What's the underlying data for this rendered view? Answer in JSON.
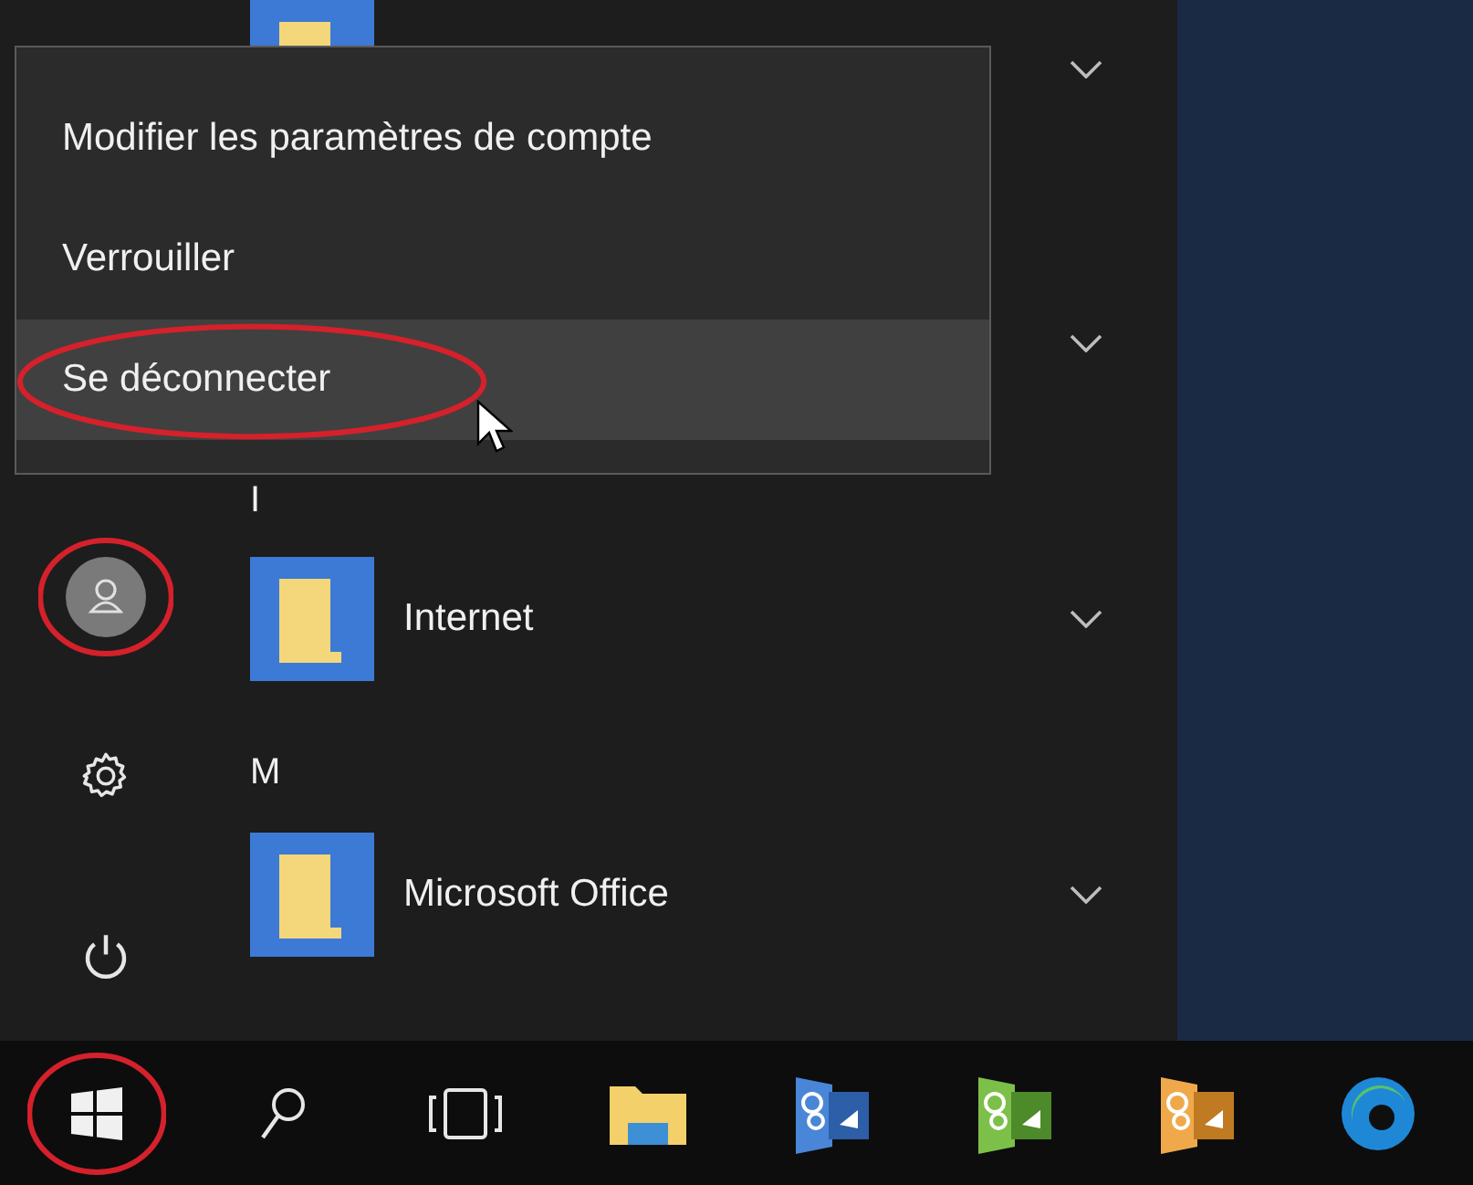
{
  "start_menu": {
    "rail": [
      {
        "kind": "user",
        "circled": true
      },
      {
        "kind": "settings",
        "circled": false
      },
      {
        "kind": "power",
        "circled": false
      }
    ],
    "apps": [
      {
        "kind": "header",
        "label": "I"
      },
      {
        "kind": "app",
        "label": "Internet"
      },
      {
        "kind": "header",
        "label": "M"
      },
      {
        "kind": "app",
        "label": "Microsoft Office"
      }
    ]
  },
  "account_menu": {
    "items": [
      {
        "label": "Modifier les paramètres de compte",
        "selected": false,
        "circled": false
      },
      {
        "label": "Verrouiller",
        "selected": false,
        "circled": false
      },
      {
        "label": "Se déconnecter",
        "selected": true,
        "circled": true
      }
    ]
  },
  "taskbar": {
    "start_circled": true,
    "items": [
      {
        "kind": "search"
      },
      {
        "kind": "task-view"
      },
      {
        "kind": "folder"
      },
      {
        "kind": "app-blue"
      },
      {
        "kind": "app-green"
      },
      {
        "kind": "app-orange"
      },
      {
        "kind": "browser"
      }
    ]
  }
}
